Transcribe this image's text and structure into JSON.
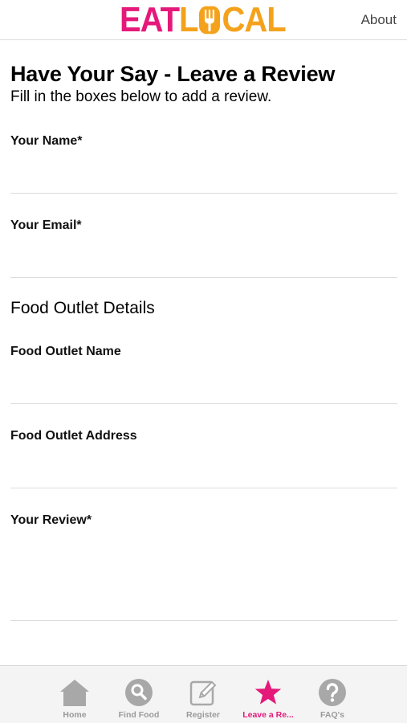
{
  "header": {
    "logo_part1": "EAT",
    "logo_part2a": "L",
    "logo_part2b": "CAL",
    "about_label": "About"
  },
  "form": {
    "title": "Have Your Say - Leave a Review",
    "subtitle": "Fill in the boxes below to add a review.",
    "fields": [
      {
        "label": "Your Name*",
        "value": "",
        "placeholder": ""
      },
      {
        "label": "Your Email*",
        "value": "",
        "placeholder": ""
      },
      {
        "label": "Food Outlet Name",
        "value": "",
        "placeholder": ""
      },
      {
        "label": "Food Outlet Address",
        "value": "",
        "placeholder": ""
      },
      {
        "label": "Your Review*",
        "value": "",
        "placeholder": ""
      }
    ],
    "section_heading": "Food Outlet Details"
  },
  "tabbar": {
    "tabs": [
      {
        "label": "Home",
        "icon": "home-icon",
        "active": false
      },
      {
        "label": "Find Food",
        "icon": "search-icon",
        "active": false
      },
      {
        "label": "Register",
        "icon": "edit-icon",
        "active": false
      },
      {
        "label": "Leave a Re...",
        "icon": "star-icon",
        "active": true
      },
      {
        "label": "FAQ's",
        "icon": "help-icon",
        "active": false
      }
    ]
  },
  "colors": {
    "brand_pink": "#e5197a",
    "brand_orange": "#f4a21c",
    "tab_inactive": "#9a9a9a"
  }
}
